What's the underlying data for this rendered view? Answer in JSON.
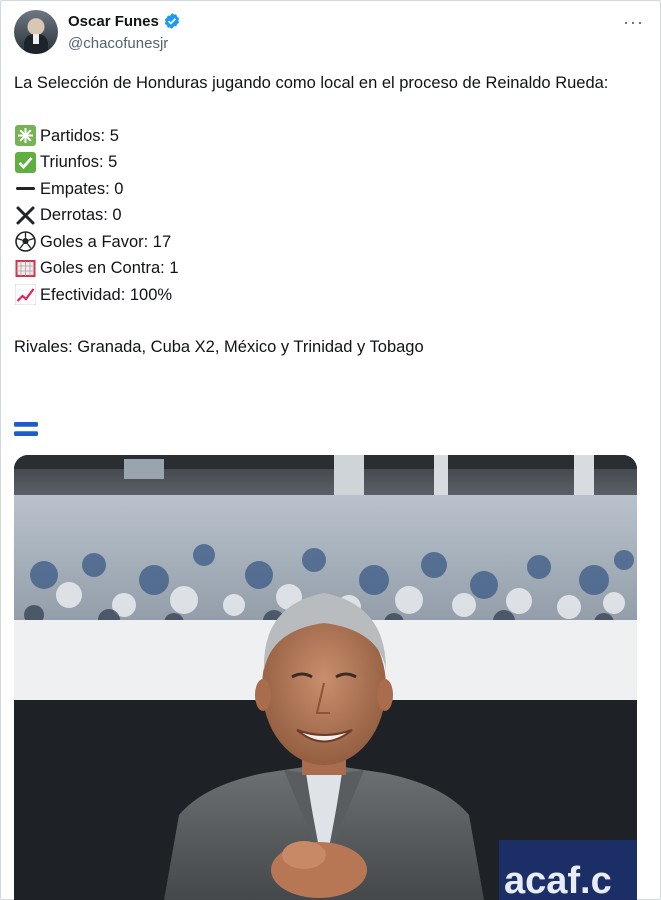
{
  "author": {
    "name": "Oscar Funes",
    "handle": "@chacofunesjr",
    "verified_icon": "verified-badge-icon",
    "more_icon": "more-options-icon"
  },
  "tweet": {
    "intro": "La Selección de Honduras jugando como local en el proceso de Reinaldo Rueda:",
    "stats": [
      {
        "icon": "sparkle-icon",
        "text": "Partidos: 5"
      },
      {
        "icon": "check-mark-icon",
        "text": "Triunfos: 5"
      },
      {
        "icon": "dash-icon",
        "text": "Empates: 0"
      },
      {
        "icon": "cross-icon",
        "text": "Derrotas: 0"
      },
      {
        "icon": "soccer-ball-icon",
        "text": "Goles a Favor: 17"
      },
      {
        "icon": "goal-net-icon",
        "text": "Goles en Contra: 1"
      },
      {
        "icon": "chart-increasing-icon",
        "text": "Efectividad: 100%"
      }
    ],
    "rivals": "Rivales: Granada, Cuba X2, México y Trinidad y Tobago",
    "flag_icon": "honduras-flag-icon"
  },
  "photo": {
    "banner_text": "acaf.c"
  },
  "colors": {
    "verified": "#1d9bf0",
    "text": "#0f1419",
    "secondary": "#536471",
    "flag_blue": "#1e5cc8"
  }
}
